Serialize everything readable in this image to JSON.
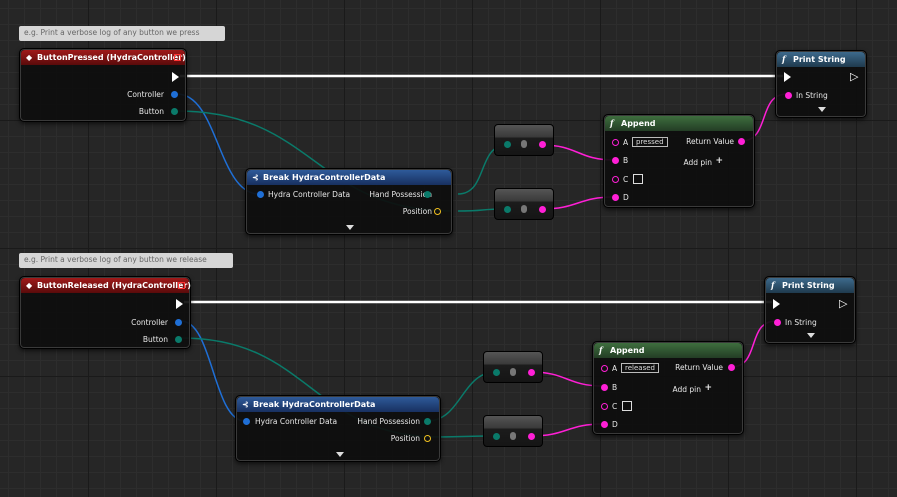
{
  "graphs": [
    {
      "comment": "e.g. Print a verbose log of any button we press",
      "event": {
        "title": "ButtonPressed (HydraController)",
        "out_controller": "Controller",
        "out_button": "Button"
      },
      "break": {
        "title": "Break HydraControllerData",
        "in_data": "Hydra Controller Data",
        "out_hand": "Hand Possession",
        "out_position": "Position"
      },
      "append": {
        "title": "Append",
        "pin_a": "A",
        "a_value": "pressed",
        "pin_b": "B",
        "pin_c": "C",
        "pin_d": "D",
        "ret": "Return Value",
        "add_pin": "Add pin"
      },
      "print": {
        "title": "Print String",
        "in_string": "In String"
      }
    },
    {
      "comment": "e.g. Print a verbose log of any button we release",
      "event": {
        "title": "ButtonReleased (HydraController)",
        "out_controller": "Controller",
        "out_button": "Button"
      },
      "break": {
        "title": "Break HydraControllerData",
        "in_data": "Hydra Controller Data",
        "out_hand": "Hand Possession",
        "out_position": "Position"
      },
      "append": {
        "title": "Append",
        "pin_a": "A",
        "a_value": "released",
        "pin_b": "B",
        "pin_c": "C",
        "pin_d": "D",
        "ret": "Return Value",
        "add_pin": "Add pin"
      },
      "print": {
        "title": "Print String",
        "in_string": "In String"
      }
    }
  ],
  "colors": {
    "exec": "#ffffff",
    "struct": "#1f6fd6",
    "byte": "#0a7a6a",
    "string": "#ff1fd6",
    "vector": "#f0c020"
  },
  "icons": {
    "event": "event-diamond-icon",
    "function": "function-f-icon",
    "break": "break-struct-icon",
    "add": "plus-icon",
    "expand": "expand-arrow-icon"
  }
}
